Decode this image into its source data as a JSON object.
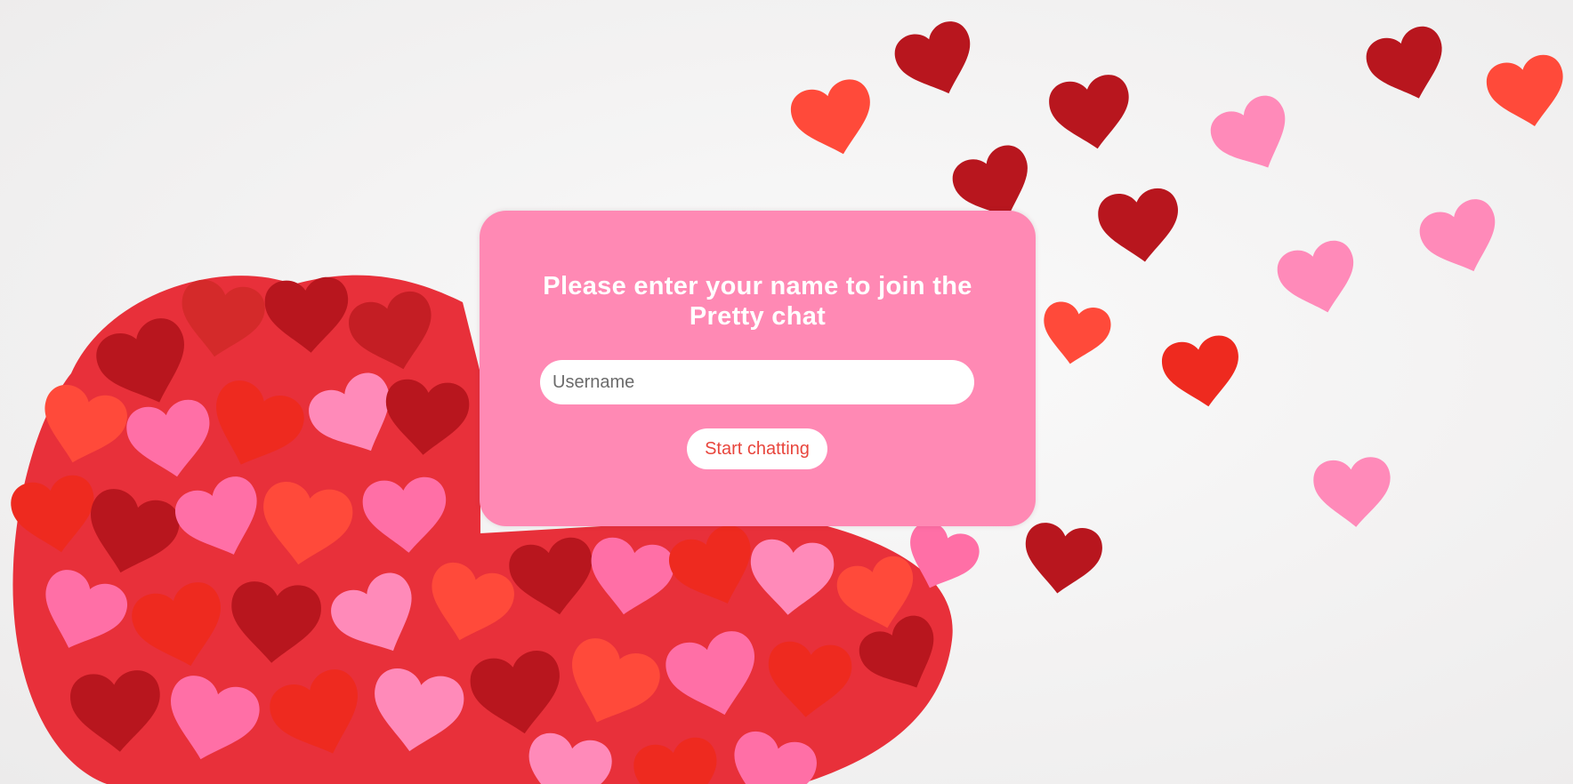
{
  "background": {
    "image": "hearts-confetti",
    "colors": {
      "deep_red": "#b8161e",
      "red": "#ee2a1f",
      "orange_red": "#ff4a3a",
      "pink": "#ff6fa6",
      "light_pink": "#ff8ab9"
    }
  },
  "join": {
    "title": "Please enter your name to join the Pretty chat",
    "username_placeholder": "Username",
    "username_value": "",
    "submit_label": "Start chatting"
  },
  "colors": {
    "card": "#ff89b4",
    "button_text": "#e8453c",
    "title_text": "#ffffff"
  }
}
